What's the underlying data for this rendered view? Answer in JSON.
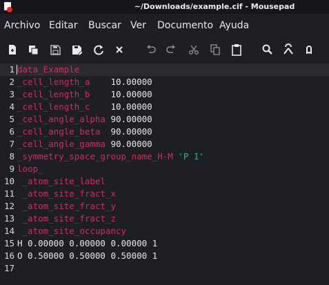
{
  "window": {
    "title": "~/Downloads/example.cif - Mousepad"
  },
  "menu": [
    "Archivo",
    "Editar",
    "Buscar",
    "Ver",
    "Documento",
    "Ayuda"
  ],
  "toolbar": {
    "icons": [
      "new-document-icon",
      "new-window-icon",
      "save-icon",
      "save-as-icon",
      "reload-icon",
      "close-icon",
      "undo-icon",
      "redo-icon",
      "cut-icon",
      "copy-icon",
      "paste-icon",
      "search-icon",
      "find-replace-icon",
      "go-to-icon"
    ]
  },
  "editor": {
    "current_line": 1,
    "lines": [
      {
        "n": "1",
        "segments": [
          {
            "t": "data_Example",
            "c": "tag"
          }
        ]
      },
      {
        "n": "2",
        "segments": [
          {
            "t": "_cell_length_a",
            "c": "tag"
          },
          {
            "t": "    10.00000",
            "c": "num"
          }
        ]
      },
      {
        "n": "3",
        "segments": [
          {
            "t": "_cell_length_b",
            "c": "tag"
          },
          {
            "t": "    10.00000",
            "c": "num"
          }
        ]
      },
      {
        "n": "4",
        "segments": [
          {
            "t": "_cell_length_c",
            "c": "tag"
          },
          {
            "t": "    10.00000",
            "c": "num"
          }
        ]
      },
      {
        "n": "5",
        "segments": [
          {
            "t": "_cell_angle_alpha",
            "c": "tag"
          },
          {
            "t": " 90.00000",
            "c": "num"
          }
        ]
      },
      {
        "n": "6",
        "segments": [
          {
            "t": "_cell_angle_beta",
            "c": "tag"
          },
          {
            "t": "  90.00000",
            "c": "num"
          }
        ]
      },
      {
        "n": "7",
        "segments": [
          {
            "t": "_cell_angle_gamma",
            "c": "tag"
          },
          {
            "t": " 90.00000",
            "c": "num"
          }
        ]
      },
      {
        "n": "8",
        "segments": [
          {
            "t": "_symmetry_space_group_name_H-M",
            "c": "tag"
          },
          {
            "t": " ",
            "c": "plain"
          },
          {
            "t": "'P 1'",
            "c": "str"
          }
        ]
      },
      {
        "n": "9",
        "segments": [
          {
            "t": "loop_",
            "c": "tag"
          }
        ]
      },
      {
        "n": "10",
        "segments": [
          {
            "t": " ",
            "c": "plain"
          },
          {
            "t": "_atom_site_label",
            "c": "tag"
          }
        ]
      },
      {
        "n": "11",
        "segments": [
          {
            "t": " ",
            "c": "plain"
          },
          {
            "t": "_atom_site_fract_x",
            "c": "tag"
          }
        ]
      },
      {
        "n": "12",
        "segments": [
          {
            "t": " ",
            "c": "plain"
          },
          {
            "t": "_atom_site_fract_y",
            "c": "tag"
          }
        ]
      },
      {
        "n": "13",
        "segments": [
          {
            "t": " ",
            "c": "plain"
          },
          {
            "t": "_atom_site_fract_z",
            "c": "tag"
          }
        ]
      },
      {
        "n": "14",
        "segments": [
          {
            "t": " ",
            "c": "plain"
          },
          {
            "t": "_atom_site_occupancy",
            "c": "tag"
          }
        ]
      },
      {
        "n": "15",
        "segments": [
          {
            "t": "H 0.00000 0.00000 0.00000 1",
            "c": "plain"
          }
        ]
      },
      {
        "n": "16",
        "segments": [
          {
            "t": "O 0.50000 0.50000 0.50000 1",
            "c": "plain"
          }
        ]
      },
      {
        "n": "17",
        "segments": []
      }
    ]
  },
  "colors": {
    "background": "#1e1f24",
    "titlebar": "#16161a",
    "keyword": "#c7325c",
    "string": "#2ab5a4",
    "text": "#e8e8e8"
  }
}
